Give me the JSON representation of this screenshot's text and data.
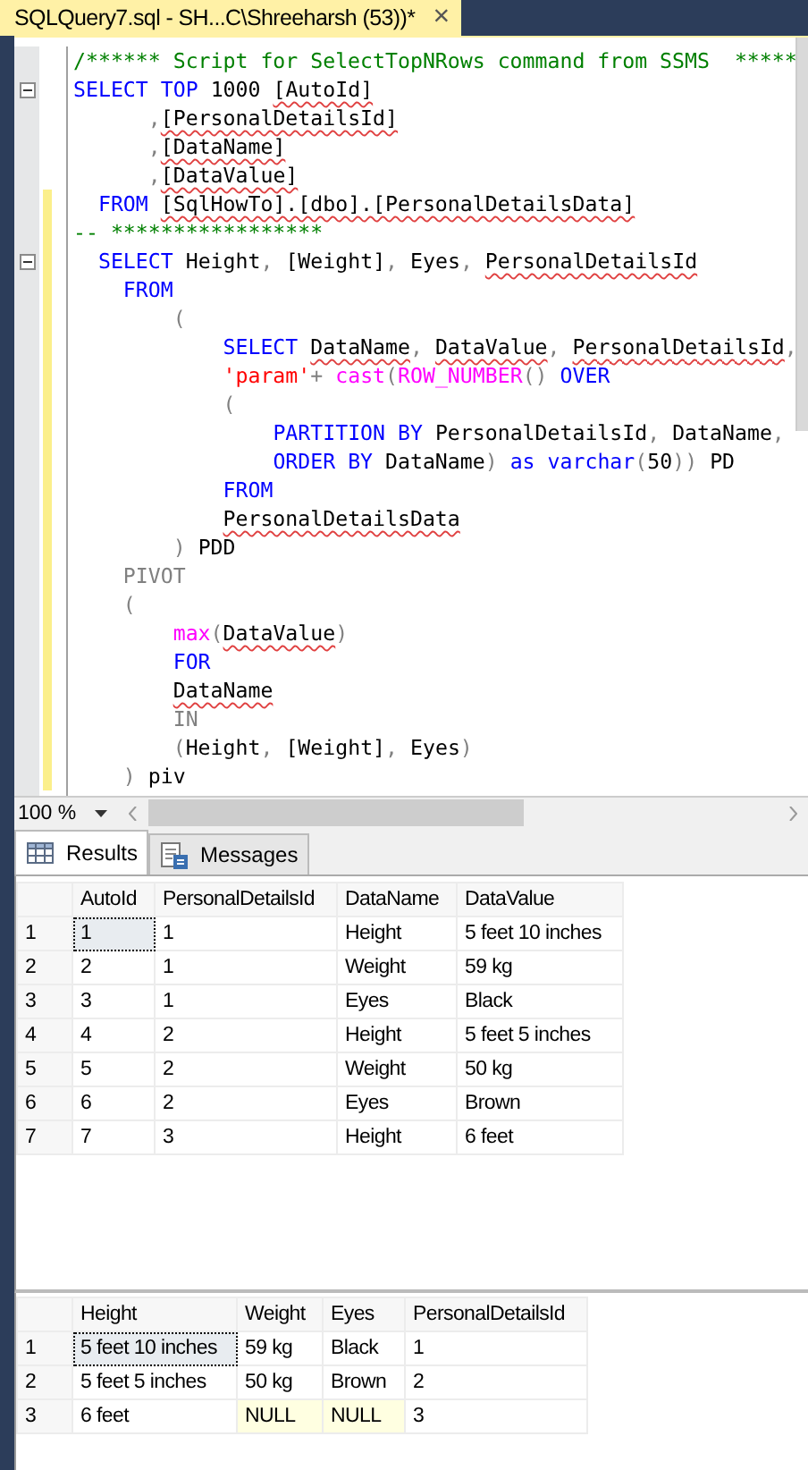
{
  "document_tab": {
    "title": "SQLQuery7.sql - SH...C\\Shreeharsh (53))*",
    "close": "×",
    "selected": true
  },
  "editor": {
    "lines": [
      {
        "fold": false,
        "changed": false,
        "tokens": [
          {
            "kind": "comment",
            "text": "/****** Script for SelectTopNRows command from SSMS  *****"
          }
        ]
      },
      {
        "fold": true,
        "changed": false,
        "tokens": [
          {
            "kind": "keyword",
            "text": "SELECT"
          },
          {
            "kind": "keyword",
            "text": " TOP"
          },
          {
            "kind": "plain",
            "text": " 1000 "
          },
          {
            "kind": "unresolved",
            "text": "[AutoId]"
          }
        ]
      },
      {
        "fold": false,
        "changed": false,
        "tokens": [
          {
            "kind": "operator",
            "text": "      ,"
          },
          {
            "kind": "unresolved",
            "text": "[PersonalDetailsId]"
          }
        ]
      },
      {
        "fold": false,
        "changed": false,
        "tokens": [
          {
            "kind": "operator",
            "text": "      ,"
          },
          {
            "kind": "unresolved",
            "text": "[DataName]"
          }
        ]
      },
      {
        "fold": false,
        "changed": false,
        "tokens": [
          {
            "kind": "operator",
            "text": "      ,"
          },
          {
            "kind": "unresolved",
            "text": "[DataValue]"
          }
        ]
      },
      {
        "fold": false,
        "changed": true,
        "tokens": [
          {
            "kind": "keyword",
            "text": "  FROM"
          },
          {
            "kind": "unresolved",
            "text": " [SqlHowTo].[dbo].[PersonalDetailsData]"
          }
        ]
      },
      {
        "fold": false,
        "changed": true,
        "tokens": [
          {
            "kind": "comment",
            "text": "-- *****************"
          }
        ]
      },
      {
        "fold": true,
        "changed": true,
        "tokens": [
          {
            "kind": "keyword",
            "text": "  SELECT"
          },
          {
            "kind": "plain",
            "text": " Height"
          },
          {
            "kind": "operator",
            "text": ","
          },
          {
            "kind": "plain",
            "text": " [Weight]"
          },
          {
            "kind": "operator",
            "text": ","
          },
          {
            "kind": "plain",
            "text": " Eyes"
          },
          {
            "kind": "operator",
            "text": ","
          },
          {
            "kind": "unresolved",
            "text": " PersonalDetailsId"
          }
        ]
      },
      {
        "fold": false,
        "changed": true,
        "tokens": [
          {
            "kind": "keyword",
            "text": "    FROM"
          }
        ]
      },
      {
        "fold": false,
        "changed": true,
        "tokens": [
          {
            "kind": "operator",
            "text": "        ("
          }
        ]
      },
      {
        "fold": false,
        "changed": true,
        "tokens": [
          {
            "kind": "keyword",
            "text": "            SELECT"
          },
          {
            "kind": "unresolved",
            "text": " DataName"
          },
          {
            "kind": "operator",
            "text": ","
          },
          {
            "kind": "unresolved",
            "text": " DataValue"
          },
          {
            "kind": "operator",
            "text": ","
          },
          {
            "kind": "unresolved",
            "text": " PersonalDetailsId"
          },
          {
            "kind": "operator",
            "text": ","
          }
        ]
      },
      {
        "fold": false,
        "changed": true,
        "tokens": [
          {
            "kind": "string",
            "text": "            'param'"
          },
          {
            "kind": "operator",
            "text": "+ "
          },
          {
            "kind": "function",
            "text": "cast"
          },
          {
            "kind": "operator",
            "text": "("
          },
          {
            "kind": "function",
            "text": "ROW_NUMBER"
          },
          {
            "kind": "operator",
            "text": "() "
          },
          {
            "kind": "keyword",
            "text": "OVER"
          }
        ]
      },
      {
        "fold": false,
        "changed": true,
        "tokens": [
          {
            "kind": "operator",
            "text": "            ("
          }
        ]
      },
      {
        "fold": false,
        "changed": true,
        "tokens": [
          {
            "kind": "keyword",
            "text": "                PARTITION BY"
          },
          {
            "kind": "plain",
            "text": " PersonalDetailsId"
          },
          {
            "kind": "operator",
            "text": ","
          },
          {
            "kind": "plain",
            "text": " DataName"
          },
          {
            "kind": "operator",
            "text": ","
          }
        ]
      },
      {
        "fold": false,
        "changed": true,
        "tokens": [
          {
            "kind": "keyword",
            "text": "                ORDER BY"
          },
          {
            "kind": "plain",
            "text": " DataName"
          },
          {
            "kind": "operator",
            "text": ")"
          },
          {
            "kind": "keyword",
            "text": " as"
          },
          {
            "kind": "keyword",
            "text": " varchar"
          },
          {
            "kind": "operator",
            "text": "("
          },
          {
            "kind": "plain",
            "text": "50"
          },
          {
            "kind": "operator",
            "text": "))"
          },
          {
            "kind": "plain",
            "text": " PD"
          }
        ]
      },
      {
        "fold": false,
        "changed": true,
        "tokens": [
          {
            "kind": "keyword",
            "text": "            FROM"
          }
        ]
      },
      {
        "fold": false,
        "changed": true,
        "tokens": [
          {
            "kind": "unresolved",
            "text": "            PersonalDetailsData"
          }
        ]
      },
      {
        "fold": false,
        "changed": true,
        "tokens": [
          {
            "kind": "operator",
            "text": "        )"
          },
          {
            "kind": "plain",
            "text": " PDD"
          }
        ]
      },
      {
        "fold": false,
        "changed": true,
        "tokens": [
          {
            "kind": "operator",
            "text": "    PIVOT"
          }
        ]
      },
      {
        "fold": false,
        "changed": true,
        "tokens": [
          {
            "kind": "operator",
            "text": "    ("
          }
        ]
      },
      {
        "fold": false,
        "changed": true,
        "tokens": [
          {
            "kind": "function",
            "text": "        max"
          },
          {
            "kind": "operator",
            "text": "("
          },
          {
            "kind": "unresolved",
            "text": "DataValue"
          },
          {
            "kind": "operator",
            "text": ")"
          }
        ]
      },
      {
        "fold": false,
        "changed": true,
        "tokens": [
          {
            "kind": "keyword",
            "text": "        FOR"
          }
        ]
      },
      {
        "fold": false,
        "changed": true,
        "tokens": [
          {
            "kind": "unresolved",
            "text": "        DataName"
          }
        ]
      },
      {
        "fold": false,
        "changed": true,
        "tokens": [
          {
            "kind": "operator",
            "text": "        IN"
          }
        ]
      },
      {
        "fold": false,
        "changed": true,
        "tokens": [
          {
            "kind": "operator",
            "text": "        ("
          },
          {
            "kind": "plain",
            "text": "Height"
          },
          {
            "kind": "operator",
            "text": ","
          },
          {
            "kind": "plain",
            "text": " [Weight]"
          },
          {
            "kind": "operator",
            "text": ","
          },
          {
            "kind": "plain",
            "text": " Eyes"
          },
          {
            "kind": "operator",
            "text": ")"
          }
        ]
      },
      {
        "fold": false,
        "changed": true,
        "tokens": [
          {
            "kind": "operator",
            "text": "    )"
          },
          {
            "kind": "plain",
            "text": " piv"
          }
        ]
      }
    ]
  },
  "zoom": {
    "value": "100 %"
  },
  "result_tabs": [
    {
      "label": "Results",
      "kind": "grid",
      "selected": true
    },
    {
      "label": "Messages",
      "kind": "messages",
      "selected": false
    }
  ],
  "grids": [
    {
      "columns": [
        "AutoId",
        "PersonalDetailsId",
        "DataName",
        "DataValue"
      ],
      "rows": [
        {
          "number": "1",
          "cells": [
            {
              "text": "1",
              "kind": "value",
              "selected": true
            },
            {
              "text": "1",
              "kind": "value",
              "selected": false
            },
            {
              "text": "Height",
              "kind": "value",
              "selected": false
            },
            {
              "text": "5 feet 10 inches",
              "kind": "value",
              "selected": false
            }
          ]
        },
        {
          "number": "2",
          "cells": [
            {
              "text": "2",
              "kind": "value",
              "selected": false
            },
            {
              "text": "1",
              "kind": "value",
              "selected": false
            },
            {
              "text": "Weight",
              "kind": "value",
              "selected": false
            },
            {
              "text": "59 kg",
              "kind": "value",
              "selected": false
            }
          ]
        },
        {
          "number": "3",
          "cells": [
            {
              "text": "3",
              "kind": "value",
              "selected": false
            },
            {
              "text": "1",
              "kind": "value",
              "selected": false
            },
            {
              "text": "Eyes",
              "kind": "value",
              "selected": false
            },
            {
              "text": "Black",
              "kind": "value",
              "selected": false
            }
          ]
        },
        {
          "number": "4",
          "cells": [
            {
              "text": "4",
              "kind": "value",
              "selected": false
            },
            {
              "text": "2",
              "kind": "value",
              "selected": false
            },
            {
              "text": "Height",
              "kind": "value",
              "selected": false
            },
            {
              "text": "5 feet 5 inches",
              "kind": "value",
              "selected": false
            }
          ]
        },
        {
          "number": "5",
          "cells": [
            {
              "text": "5",
              "kind": "value",
              "selected": false
            },
            {
              "text": "2",
              "kind": "value",
              "selected": false
            },
            {
              "text": "Weight",
              "kind": "value",
              "selected": false
            },
            {
              "text": "50 kg",
              "kind": "value",
              "selected": false
            }
          ]
        },
        {
          "number": "6",
          "cells": [
            {
              "text": "6",
              "kind": "value",
              "selected": false
            },
            {
              "text": "2",
              "kind": "value",
              "selected": false
            },
            {
              "text": "Eyes",
              "kind": "value",
              "selected": false
            },
            {
              "text": "Brown",
              "kind": "value",
              "selected": false
            }
          ]
        },
        {
          "number": "7",
          "cells": [
            {
              "text": "7",
              "kind": "value",
              "selected": false
            },
            {
              "text": "3",
              "kind": "value",
              "selected": false
            },
            {
              "text": "Height",
              "kind": "value",
              "selected": false
            },
            {
              "text": "6 feet",
              "kind": "value",
              "selected": false
            }
          ]
        }
      ]
    },
    {
      "columns": [
        "Height",
        "Weight",
        "Eyes",
        "PersonalDetailsId"
      ],
      "rows": [
        {
          "number": "1",
          "cells": [
            {
              "text": "5 feet 10 inches",
              "kind": "value",
              "selected": true
            },
            {
              "text": "59 kg",
              "kind": "value",
              "selected": false
            },
            {
              "text": "Black",
              "kind": "value",
              "selected": false
            },
            {
              "text": "1",
              "kind": "value",
              "selected": false
            }
          ]
        },
        {
          "number": "2",
          "cells": [
            {
              "text": "5 feet 5 inches",
              "kind": "value",
              "selected": false
            },
            {
              "text": "50 kg",
              "kind": "value",
              "selected": false
            },
            {
              "text": "Brown",
              "kind": "value",
              "selected": false
            },
            {
              "text": "2",
              "kind": "value",
              "selected": false
            }
          ]
        },
        {
          "number": "3",
          "cells": [
            {
              "text": "6 feet",
              "kind": "value",
              "selected": false
            },
            {
              "text": "NULL",
              "kind": "null",
              "selected": false
            },
            {
              "text": "NULL",
              "kind": "null",
              "selected": false
            },
            {
              "text": "3",
              "kind": "value",
              "selected": false
            }
          ]
        }
      ]
    }
  ]
}
